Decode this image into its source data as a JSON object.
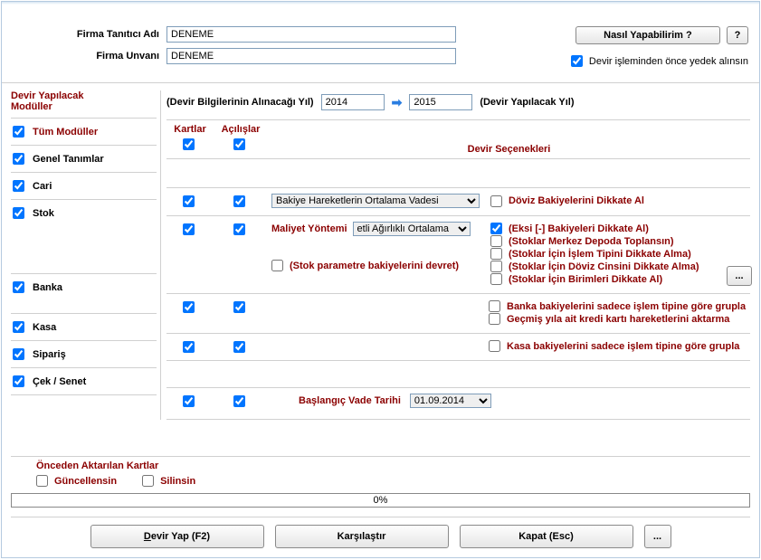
{
  "header": {
    "firma_tanitici_label": "Firma Tanıtıcı Adı",
    "firma_tanitici_value": "DENEME",
    "firma_unvani_label": "Firma Unvanı",
    "firma_unvani_value": "DENEME",
    "help_button": "Nasıl Yapabilirim ?",
    "help_q": "?",
    "backup_label": "Devir işleminden önce yedek alınsın"
  },
  "left": {
    "modules_title1": "Devir Yapılacak",
    "modules_title2": "Modüller",
    "all_modules": "Tüm Modüller",
    "genel": "Genel Tanımlar",
    "cari": "Cari",
    "stok": "Stok",
    "banka": "Banka",
    "kasa": "Kasa",
    "siparis": "Sipariş",
    "ceksenet": "Çek / Senet"
  },
  "year_row": {
    "info_year_label": "(Devir Bilgilerinin Alınacağı Yıl)",
    "from_year": "2014",
    "to_year": "2015",
    "target_year_label": "(Devir Yapılacak Yıl)"
  },
  "cols": {
    "kartlar": "Kartlar",
    "acilislar": "Açılışlar",
    "secenekler": "Devir Seçenekleri"
  },
  "cari_opts": {
    "combo": "Bakiye Hareketlerin Ortalama Vadesi",
    "doviz": "Döviz Bakiyelerini Dikkate Al"
  },
  "stok_opts": {
    "maliyet_label": "Maliyet Yöntemi",
    "maliyet_combo": "etli Ağırlıklı Ortalama",
    "param_devret": "(Stok parametre bakiyelerini devret)",
    "eksi": "(Eksi [-] Bakiyeleri Dikkate Al)",
    "merkez": "(Stoklar Merkez Depoda Toplansın)",
    "islem": "(Stoklar İçin İşlem Tipini Dikkate Alma)",
    "doviz": "(Stoklar İçin Döviz Cinsini Dikkate Alma)",
    "birim": "(Stoklar İçin Birimleri Dikkate Al)",
    "ellipsis": "..."
  },
  "banka_opts": {
    "grupla": "Banka bakiyelerini sadece işlem tipine göre grupla",
    "gecmis": "Geçmiş yıla ait kredi kartı hareketlerini aktarma"
  },
  "kasa_opts": {
    "grupla": "Kasa bakiyelerini sadece işlem tipine göre grupla"
  },
  "ceksenet_opts": {
    "baslangic_label": "Başlangıç Vade Tarihi",
    "date_value": "01.09.2014"
  },
  "footer": {
    "prev_cards_title": "Önceden Aktarılan Kartlar",
    "guncellensin": "Güncellensin",
    "silinsin": "Silinsin",
    "progress_text": "0%",
    "devir_yap": "Devir Yap (F2)",
    "karsilastir": "Karşılaştır",
    "kapat": "Kapat (Esc)",
    "ellipsis": "..."
  }
}
